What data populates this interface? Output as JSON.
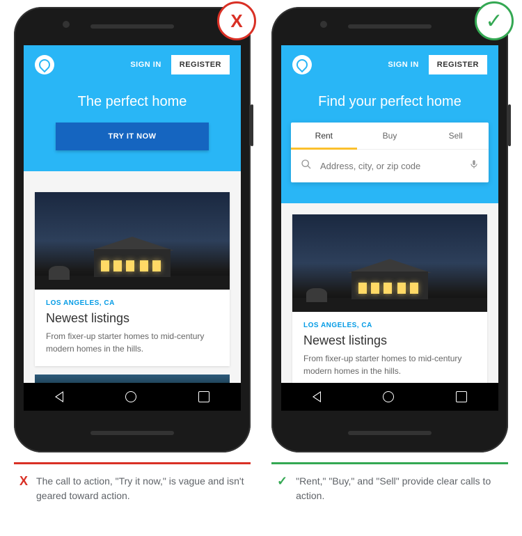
{
  "bad": {
    "badge_symbol": "X",
    "signin": "SIGN IN",
    "register": "REGISTER",
    "headline": "The perfect home",
    "cta": "TRY IT NOW",
    "card": {
      "location": "LOS ANGELES, CA",
      "title": "Newest listings",
      "desc": "From fixer-up starter homes to mid-century modern homes in the hills."
    },
    "caption_symbol": "X",
    "caption": "The call to action, \"Try it now,\" is vague and isn't geared toward action."
  },
  "good": {
    "badge_symbol": "✓",
    "signin": "SIGN IN",
    "register": "REGISTER",
    "headline": "Find your perfect home",
    "tabs": {
      "rent": "Rent",
      "buy": "Buy",
      "sell": "Sell"
    },
    "search_placeholder": "Address, city, or zip code",
    "card": {
      "location": "LOS ANGELES, CA",
      "title": "Newest listings",
      "desc": "From fixer-up starter homes to mid-century modern homes in the hills."
    },
    "caption_symbol": "✓",
    "caption": "\"Rent,\" \"Buy,\" and \"Sell\" provide clear calls to action."
  }
}
